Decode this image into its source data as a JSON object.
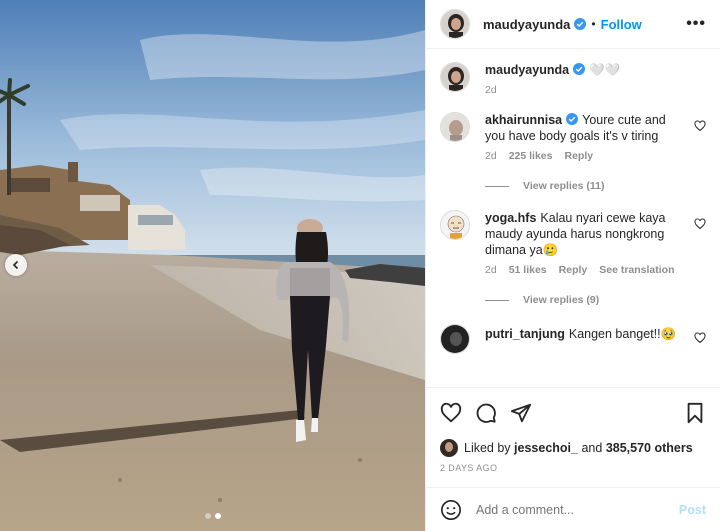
{
  "post": {
    "username": "maudyayunda",
    "follow_label": "Follow",
    "bullet": "•",
    "more_label": "•••"
  },
  "caption": {
    "username": "maudyayunda",
    "text": "🤍🤍",
    "time": "2d"
  },
  "comments": [
    {
      "username": "akhairunnisa",
      "verified": true,
      "text": "Youre cute and you have body goals it's v tiring",
      "time": "2d",
      "likes": "225 likes",
      "reply": "Reply",
      "translate": "",
      "view_replies": "View replies (11)"
    },
    {
      "username": "yoga.hfs",
      "verified": false,
      "text": "Kalau nyari cewe kaya maudy ayunda harus nongkrong dimana ya🥲",
      "time": "2d",
      "likes": "51 likes",
      "reply": "Reply",
      "translate": "See translation",
      "view_replies": "View replies (9)"
    },
    {
      "username": "putri_tanjung",
      "verified": false,
      "text": "Kangen banget!!🥹"
    }
  ],
  "liked_by": {
    "prefix": "Liked by",
    "user": "jessechoi_",
    "connector": "and",
    "others": "385,570 others"
  },
  "timestamp": "2 DAYS AGO",
  "composer": {
    "placeholder": "Add a comment...",
    "post_label": "Post"
  },
  "carousel": {
    "slides": 2,
    "active": 2
  },
  "colors": {
    "accent": "#0095f6",
    "verified": "#3897f0",
    "muted": "#8e8e8e"
  },
  "icons": [
    "heart-icon",
    "comment-icon",
    "share-icon",
    "bookmark-icon",
    "emoji-icon",
    "chevron-left-icon",
    "more-icon"
  ]
}
